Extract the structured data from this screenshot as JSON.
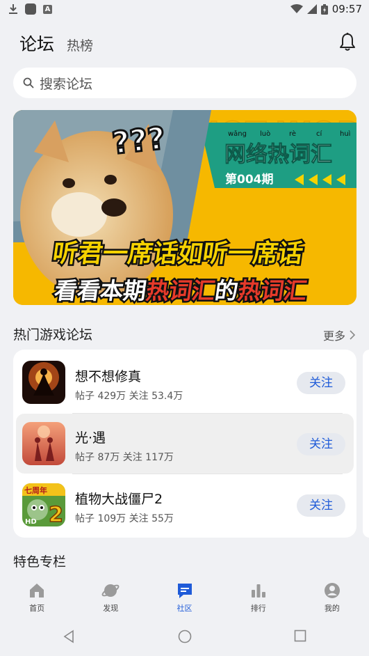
{
  "status_bar": {
    "time": "09:57",
    "left_badge": "A"
  },
  "header": {
    "title": "论坛",
    "secondary_tab": "热榜"
  },
  "search": {
    "placeholder": "搜索论坛"
  },
  "banner": {
    "pinyin": [
      "wǎng",
      "luò",
      "rè",
      "cí",
      "huì"
    ],
    "title": "网络热词汇",
    "issue": "第004期",
    "question_marks": "???",
    "line1": "听君一席话如听一席话",
    "line2_prefix": "看看本期",
    "line2_highlight1": "热词汇",
    "line2_mid": "的",
    "line2_highlight2": "热词汇",
    "watermark": "HOT WORDS COLLECTIONS"
  },
  "hot_forums": {
    "title": "热门游戏论坛",
    "more_label": "更多",
    "items": [
      {
        "name": "想不想修真",
        "stats": "帖子 429万  关注 53.4万",
        "follow_label": "关注"
      },
      {
        "name": "光·遇",
        "stats": "帖子 87万  关注 117万",
        "follow_label": "关注"
      },
      {
        "name": "植物大战僵尸2",
        "stats": "帖子 109万  关注 55万",
        "follow_label": "关注",
        "badge": "七周年"
      }
    ]
  },
  "featured": {
    "title": "特色专栏"
  },
  "tabbar": {
    "items": [
      {
        "label": "首页",
        "icon": "home-icon"
      },
      {
        "label": "发现",
        "icon": "planet-icon"
      },
      {
        "label": "社区",
        "icon": "chat-icon",
        "active": true
      },
      {
        "label": "排行",
        "icon": "ranking-icon"
      },
      {
        "label": "我的",
        "icon": "profile-icon"
      }
    ]
  },
  "colors": {
    "accent": "#1f5bd8",
    "background": "#f0f1f4",
    "card": "#ffffff",
    "banner_yellow": "#f6b800",
    "banner_teal": "#1e9e83"
  }
}
